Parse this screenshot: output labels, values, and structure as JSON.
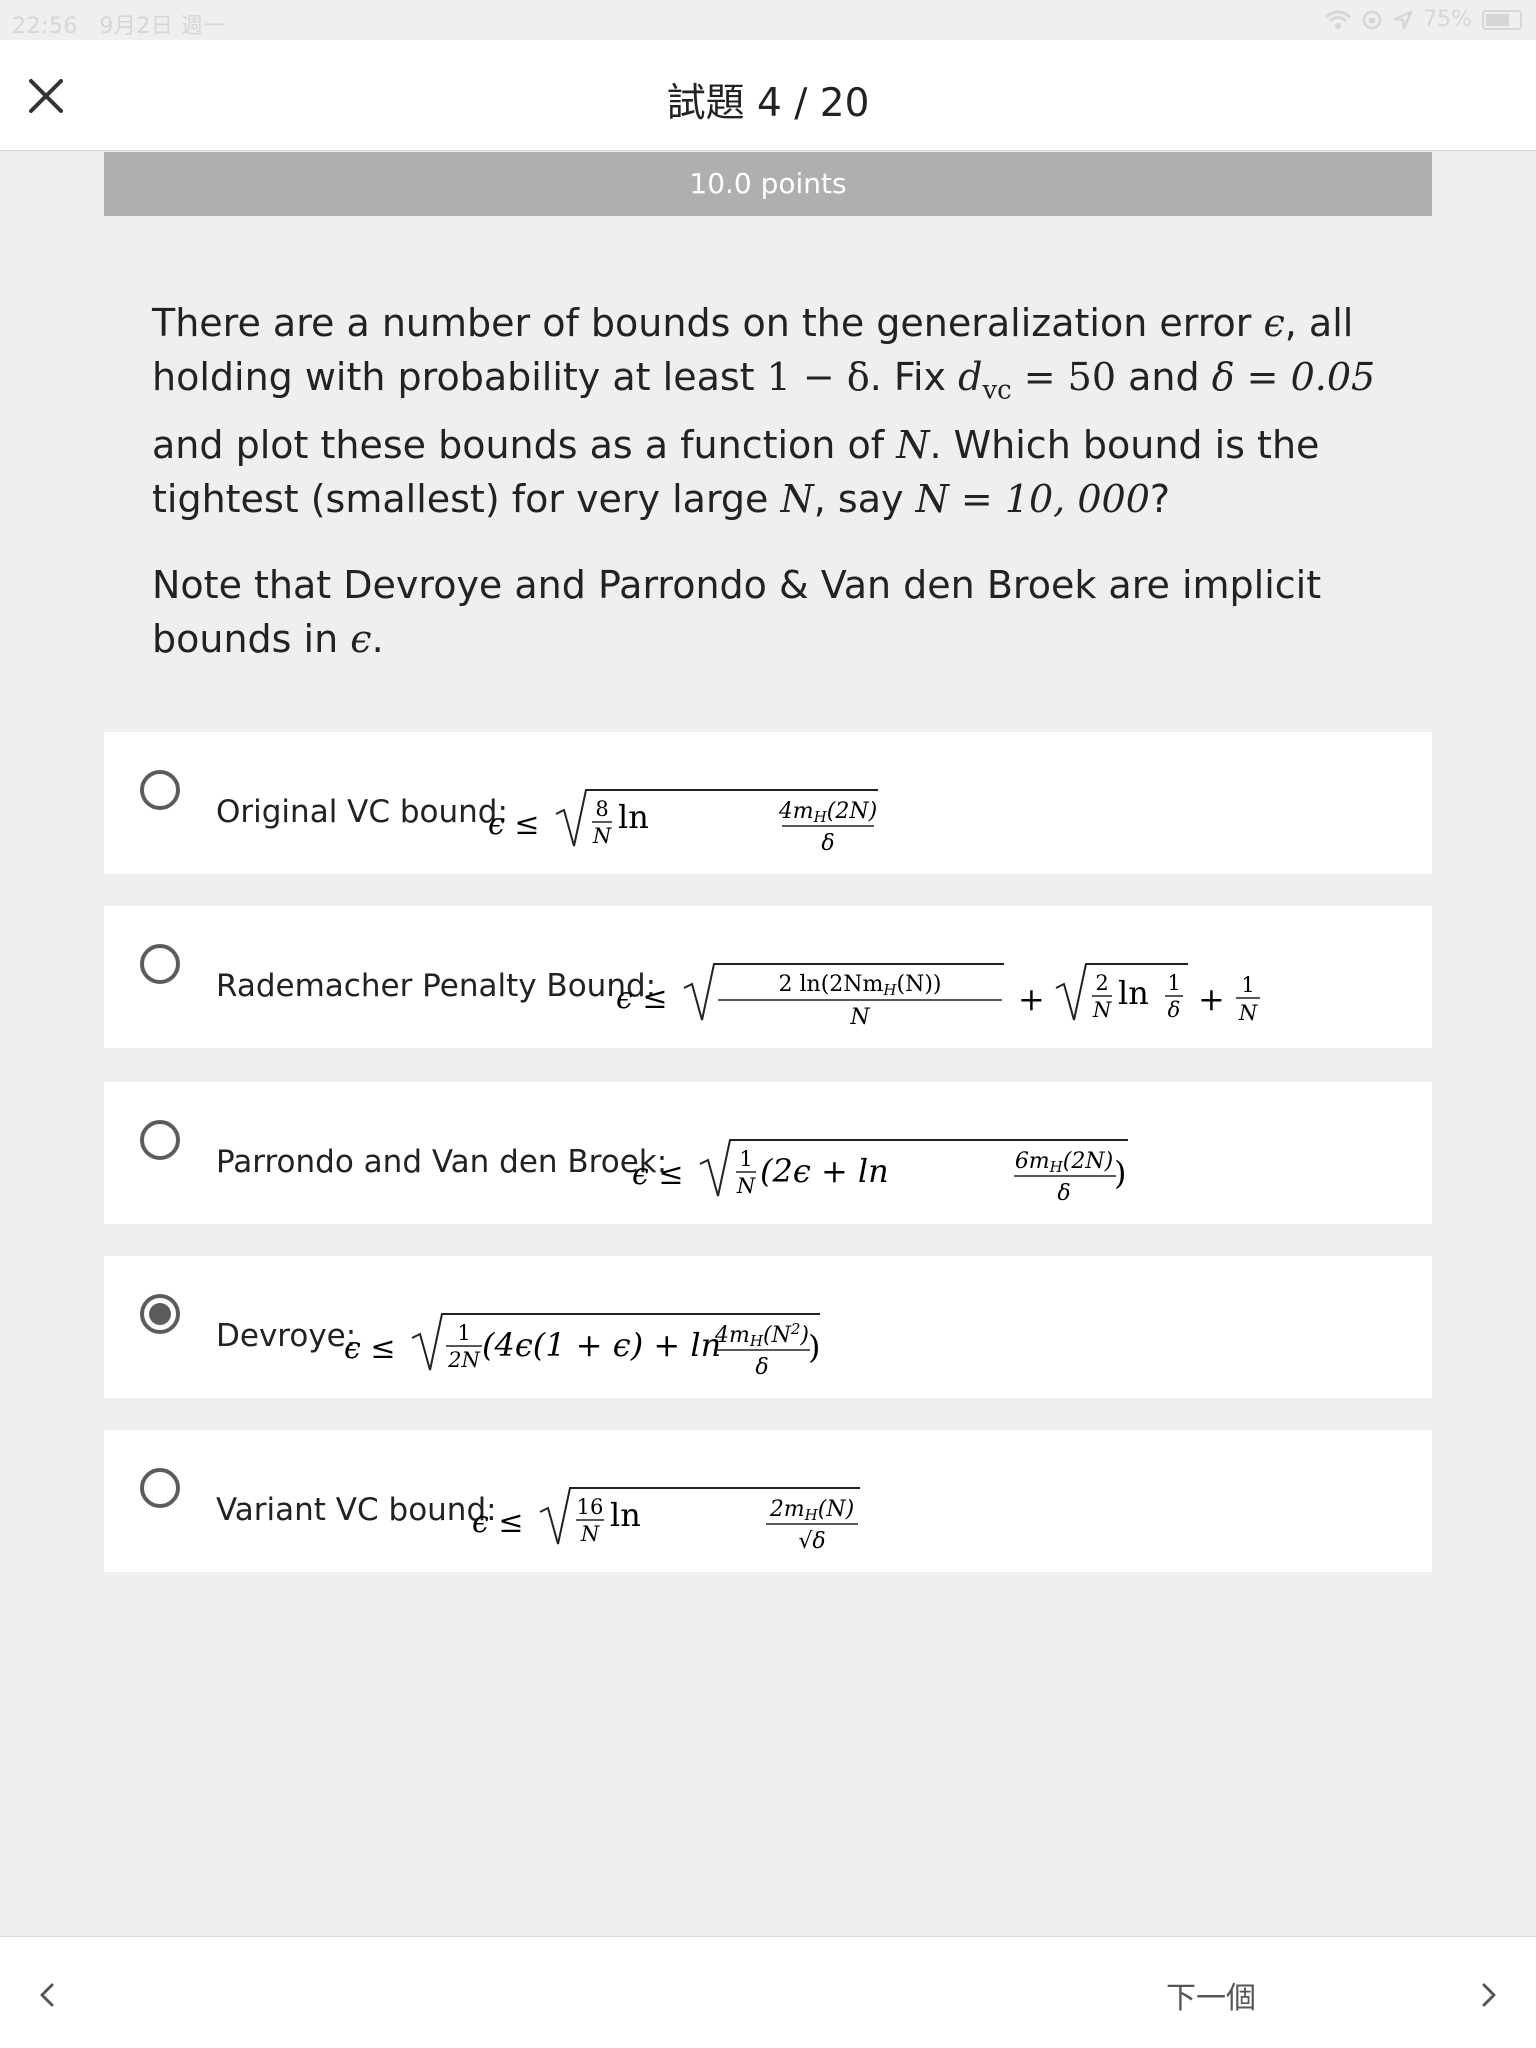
{
  "status_bar": {
    "time": "22:56",
    "date": "9月2日 週一",
    "battery_text": "75%",
    "battery_level": 0.75
  },
  "header": {
    "title": "試題 4 / 20",
    "close_icon": "close-icon"
  },
  "points": {
    "label": "10.0 points"
  },
  "question": {
    "p1": {
      "t1": "There are a number of bounds on the generalization error ",
      "t2": ", all holding with probability at least ",
      "t3": ". Fix ",
      "t4": " and ",
      "t5": " and plot these bounds as a function of ",
      "t6": ". Which bound is the tightest (smallest) for very large ",
      "t7": ", say ",
      "t8": "?",
      "m_eps": "ϵ",
      "m_prob": "1 − δ",
      "m_dvc": "d",
      "m_dvc_sub": "vc",
      "m_dvc_eq": " = 50",
      "m_delta": "δ = 0.05",
      "m_N": "N",
      "m_N10000": "N = 10, 000"
    },
    "p2": {
      "t1": "Note that Devroye and Parrondo & Van den Broek are implicit bounds in ",
      "m_eps": "ϵ",
      "t2": "."
    }
  },
  "options": [
    {
      "label": "Original VC bound: ",
      "selected": false
    },
    {
      "label": "Rademacher Penalty Bound: ",
      "selected": false
    },
    {
      "label": "Parrondo and Van den Broek: ",
      "selected": false
    },
    {
      "label": "Devroye: ",
      "selected": true
    },
    {
      "label": "Variant VC bound: ",
      "selected": false
    }
  ],
  "formulas": {
    "f0": {
      "lhs": "ϵ ≤",
      "num": "8",
      "den": "N",
      "ln": "ln",
      "inner_num": "4m",
      "inner_sub": "H",
      "inner_num_tail": "(2N)",
      "inner_den": "δ"
    },
    "f1": {
      "lhs": "ϵ ≤",
      "a_num": "2 ln(2Nm",
      "a_sub": "H",
      "a_num_tail": "(N))",
      "a_den": "N",
      "plus1": "+",
      "b_num": "2",
      "b_den": "N",
      "ln": "ln",
      "c_num": "1",
      "c_den": "δ",
      "plus2": "+",
      "d_num": "1",
      "d_den": "N"
    },
    "f2": {
      "lhs": "ϵ ≤",
      "num": "1",
      "den": "N",
      "mid": "(2ϵ + ln",
      "inner_num": "6m",
      "inner_sub": "H",
      "inner_num_tail": "(2N)",
      "inner_den": "δ",
      "close": ")"
    },
    "f3": {
      "lhs": "ϵ ≤",
      "num": "1",
      "den": "2N",
      "mid": "(4ϵ(1 + ϵ) + ln",
      "inner_num": "4m",
      "inner_sub": "H",
      "inner_num_tail": "(N",
      "inner_sup": "2",
      "inner_num_close": ")",
      "inner_den": "δ",
      "close": ")"
    },
    "f4": {
      "lhs": "ϵ ≤",
      "num": "16",
      "den": "N",
      "ln": "ln",
      "inner_num": "2m",
      "inner_sub": "H",
      "inner_num_tail": "(N)",
      "inner_den": "√δ"
    }
  },
  "footer": {
    "next_label": "下一個",
    "prev_icon": "chevron-left-icon",
    "next_icon": "chevron-right-icon"
  }
}
